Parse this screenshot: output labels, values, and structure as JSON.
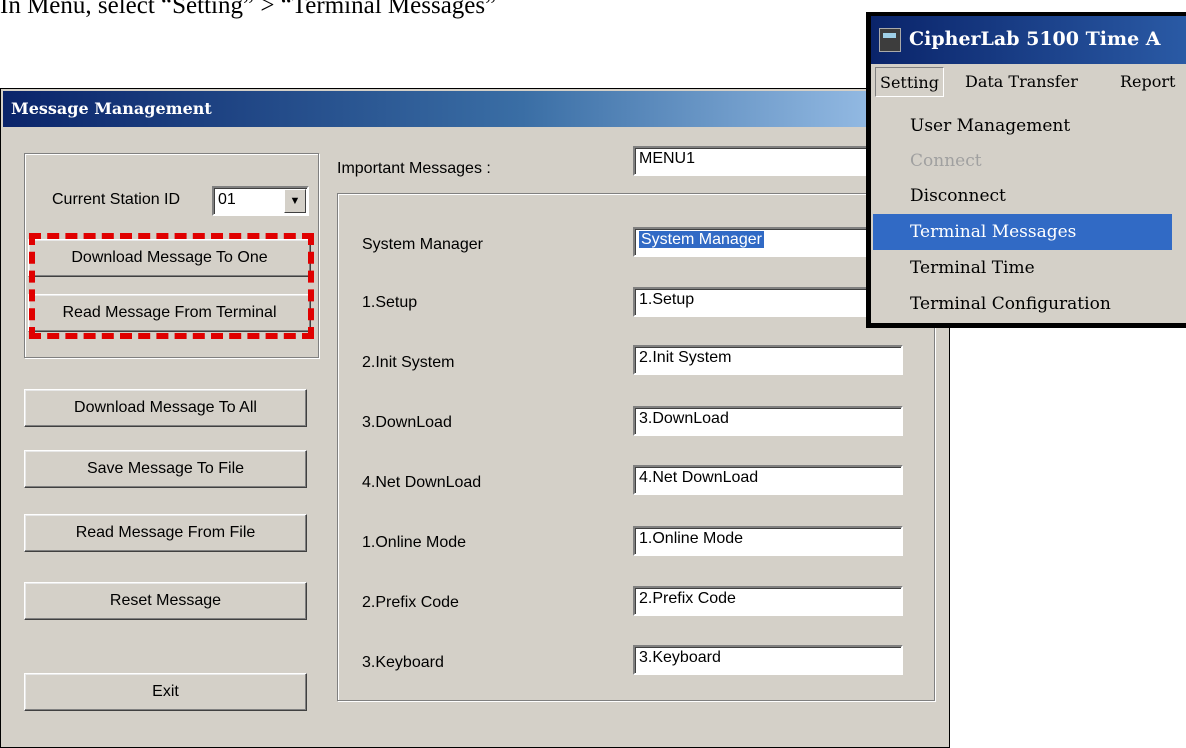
{
  "instruction": "In Menu, select “Setting” > “Terminal Messages”",
  "dialog": {
    "title": "Message Management",
    "station_label": "Current Station ID",
    "station_value": "01",
    "buttons": {
      "download_one": "Download Message To One",
      "read_terminal": "Read Message From Terminal",
      "download_all": "Download Message To All",
      "save_file": "Save Message To File",
      "read_file": "Read Message From File",
      "reset": "Reset Message",
      "exit": "Exit"
    },
    "important_label": "Important Messages :",
    "important_value": "MENU1",
    "rows": [
      {
        "label": "System Manager",
        "value": "System Manager"
      },
      {
        "label": "1.Setup",
        "value": "1.Setup"
      },
      {
        "label": "2.Init System",
        "value": "2.Init System"
      },
      {
        "label": "3.DownLoad",
        "value": "3.DownLoad"
      },
      {
        "label": "4.Net DownLoad",
        "value": "4.Net DownLoad"
      },
      {
        "label": "1.Online Mode",
        "value": "1.Online Mode"
      },
      {
        "label": "2.Prefix Code",
        "value": "2.Prefix Code"
      },
      {
        "label": "3.Keyboard",
        "value": "3.Keyboard"
      }
    ]
  },
  "menu": {
    "app_title": "CipherLab 5100 Time A",
    "bar": [
      "Setting",
      "Data Transfer",
      "Report"
    ],
    "items": [
      {
        "label": "User Management",
        "state": "normal"
      },
      {
        "label": "Connect",
        "state": "disabled"
      },
      {
        "label": "Disconnect",
        "state": "normal"
      },
      {
        "label": "Terminal Messages",
        "state": "highlighted"
      },
      {
        "label": "Terminal Time",
        "state": "normal"
      },
      {
        "label": "Terminal Configuration",
        "state": "normal"
      }
    ]
  },
  "colors": {
    "title_bar": "#0a246a",
    "highlight": "#316ac5",
    "annotation": "#e00000",
    "dialog_bg": "#d4d0c8"
  },
  "icons": {
    "app_icon": "cipherlab-terminal-icon",
    "dropdown_arrow": "chevron-down-icon"
  }
}
